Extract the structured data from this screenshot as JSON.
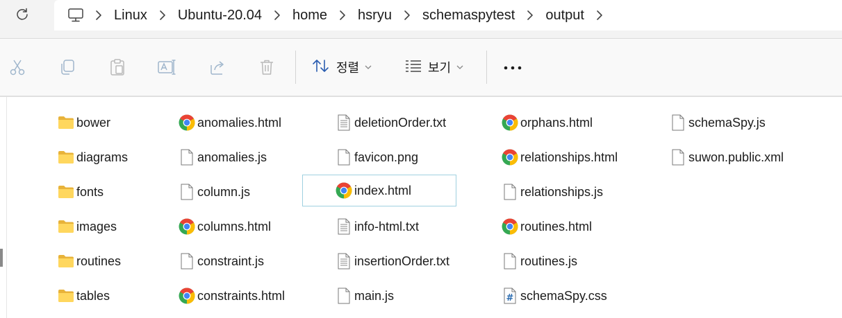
{
  "address_bar": {
    "refresh_icon": "refresh-icon",
    "pc_icon": "this-pc-icon",
    "separator_icon": "chevron-right-icon",
    "crumbs": [
      "Linux",
      "Ubuntu-20.04",
      "home",
      "hsryu",
      "schemaspytest",
      "output"
    ]
  },
  "toolbar": {
    "actions": [
      "cut-icon",
      "copy-icon",
      "paste-icon",
      "rename-icon",
      "share-icon",
      "delete-icon"
    ],
    "sort_label": "정렬",
    "view_label": "보기",
    "more_icon": "more-icon"
  },
  "files": {
    "col1": [
      {
        "name": "bower",
        "icon": "folder-icon"
      },
      {
        "name": "diagrams",
        "icon": "folder-icon"
      },
      {
        "name": "fonts",
        "icon": "folder-icon"
      },
      {
        "name": "images",
        "icon": "folder-icon"
      },
      {
        "name": "routines",
        "icon": "folder-icon"
      },
      {
        "name": "tables",
        "icon": "folder-icon"
      }
    ],
    "col2": [
      {
        "name": "anomalies.html",
        "icon": "chrome-icon"
      },
      {
        "name": "anomalies.js",
        "icon": "file-icon"
      },
      {
        "name": "column.js",
        "icon": "file-icon"
      },
      {
        "name": "columns.html",
        "icon": "chrome-icon"
      },
      {
        "name": "constraint.js",
        "icon": "file-icon"
      },
      {
        "name": "constraints.html",
        "icon": "chrome-icon"
      }
    ],
    "col3": [
      {
        "name": "deletionOrder.txt",
        "icon": "text-file-icon"
      },
      {
        "name": "favicon.png",
        "icon": "file-icon"
      },
      {
        "name": "index.html",
        "icon": "chrome-icon",
        "selected": true
      },
      {
        "name": "info-html.txt",
        "icon": "text-file-icon"
      },
      {
        "name": "insertionOrder.txt",
        "icon": "text-file-icon"
      },
      {
        "name": "main.js",
        "icon": "file-icon"
      }
    ],
    "col4": [
      {
        "name": "orphans.html",
        "icon": "chrome-icon"
      },
      {
        "name": "relationships.html",
        "icon": "chrome-icon"
      },
      {
        "name": "relationships.js",
        "icon": "file-icon"
      },
      {
        "name": "routines.html",
        "icon": "chrome-icon"
      },
      {
        "name": "routines.js",
        "icon": "file-icon"
      },
      {
        "name": "schemaSpy.css",
        "icon": "css-file-icon"
      }
    ],
    "col5": [
      {
        "name": "schemaSpy.js",
        "icon": "file-icon"
      },
      {
        "name": "suwon.public.xml",
        "icon": "file-icon"
      }
    ]
  },
  "colors": {
    "folder": "#ffd75e",
    "selection_border": "#9fd0e0",
    "toolbar_bg": "#f9f9f9",
    "address_bg": "#f3f3f3"
  }
}
